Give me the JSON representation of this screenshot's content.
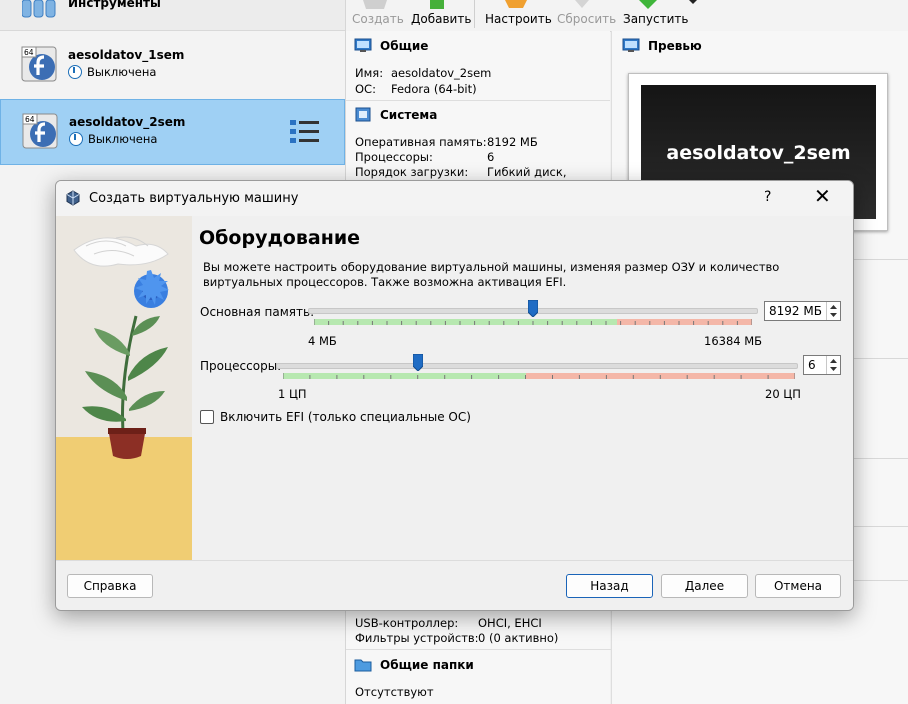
{
  "sidebar": {
    "tools_label": "Инструменты",
    "vms": [
      {
        "name": "aesoldatov_1sem",
        "state": "Выключена",
        "badge": "64"
      },
      {
        "name": "aesoldatov_2sem",
        "state": "Выключена",
        "badge": "64"
      }
    ]
  },
  "toolbar": {
    "create": "Создать",
    "add": "Добавить",
    "settings": "Настроить",
    "discard": "Сбросить",
    "start": "Запустить"
  },
  "details": {
    "general": {
      "title": "Общие",
      "name_key": "Имя:",
      "name_val": "aesoldatov_2sem",
      "os_key": "ОС:",
      "os_val": "Fedora (64-bit)"
    },
    "system": {
      "title": "Система",
      "ram_key": "Оперативная память:",
      "ram_val": "8192 МБ",
      "cpu_key": "Процессоры:",
      "cpu_val": "6",
      "boot_key": "Порядок загрузки:",
      "boot_val": "Гибкий диск,"
    },
    "usb": {
      "controller_key": "USB-контроллер:",
      "controller_val": "OHCI, EHCI",
      "filters_key": "Фильтры устройств:",
      "filters_val": "0 (0 активно)"
    },
    "shared": {
      "title": "Общие папки",
      "value": "Отсутствуют"
    }
  },
  "preview": {
    "title": "Превью",
    "screen_text": "aesoldatov_2sem"
  },
  "dialog": {
    "title": "Создать виртуальную машину",
    "help_glyph": "?",
    "close_glyph": "✕",
    "page_title": "Оборудование",
    "description": "Вы можете настроить оборудование виртуальной машины, изменяя размер ОЗУ и количество виртуальных процессоров. Также возможна активация EFI.",
    "memory": {
      "label": "Основная память:",
      "value": "8192 МБ",
      "min_label": "4 МБ",
      "max_label": "16384 МБ",
      "fraction": 0.5
    },
    "cpus": {
      "label": "Процессоры:",
      "value": "6",
      "min_label": "1 ЦП",
      "max_label": "20 ЦП",
      "fraction": 0.263
    },
    "efi": {
      "label": "Включить EFI (только специальные ОС)",
      "checked": false
    },
    "buttons": {
      "help": "Справка",
      "back": "Назад",
      "next": "Далее",
      "cancel": "Отмена"
    }
  },
  "colors": {
    "selection": "#9fd0f4",
    "accent": "#1a64b8",
    "slider_ok": "#b7e8b0",
    "slider_warn": "#f4b7a8"
  }
}
